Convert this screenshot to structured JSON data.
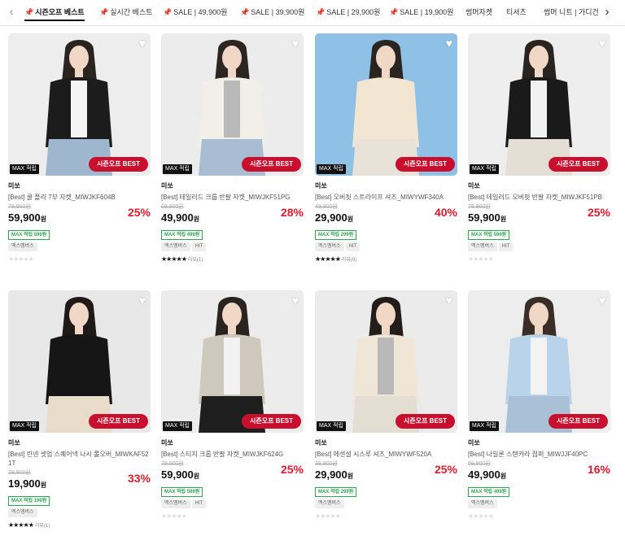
{
  "tabs": [
    {
      "label": "시즌오프 베스트",
      "pin": true,
      "active": true
    },
    {
      "label": "실시간 베스트",
      "pin": true,
      "active": false
    },
    {
      "label": "SALE | 49,900원",
      "pin": true,
      "active": false
    },
    {
      "label": "SALE | 39,900원",
      "pin": true,
      "active": false
    },
    {
      "label": "SALE | 29,900원",
      "pin": true,
      "active": false
    },
    {
      "label": "SALE | 19,900원",
      "pin": true,
      "active": false
    },
    {
      "label": "썸머자켓",
      "pin": false,
      "active": false
    },
    {
      "label": "티셔츠",
      "pin": false,
      "active": false
    },
    {
      "label": "썸머 니트 | 가디건",
      "pin": false,
      "active": false
    }
  ],
  "icons": {
    "prev": "chevron-left-icon",
    "next": "chevron-right-icon",
    "pin": "pin-icon",
    "heart": "heart-icon",
    "star": "star-icon"
  },
  "colors": {
    "accent_red": "#c8102e",
    "discount_red": "#e0192f",
    "max_green": "#2ca650"
  },
  "badges": {
    "max": "MAX 적립",
    "season": "시즌오프 BEST"
  },
  "currency": "원",
  "products": [
    {
      "brand": "미쏘",
      "name": "[Best] 쿨 플리 7부 자켓_MIWJKF604B",
      "orig_price": "79,900원",
      "price": "59,900",
      "rate": "25%",
      "max_point": "MAX 적립 599원",
      "tags": [
        "멕스멤버스"
      ],
      "rating_filled": 0,
      "review": "",
      "img": {
        "bg": "#ededed",
        "top": "#1c1c1c",
        "inner": "#f4f4f4",
        "bottom": "#9fb6cf",
        "hair": "#2a2421"
      }
    },
    {
      "brand": "미쏘",
      "name": "[Best] 테일러드 크롭 반팔 자켓_MIWJKF51PG",
      "orig_price": "69,900원",
      "price": "49,900",
      "rate": "28%",
      "max_point": "MAX 적립 499원",
      "tags": [
        "멕스멤버스",
        "HIT"
      ],
      "rating_filled": 5,
      "review": "리뷰(1)",
      "img": {
        "bg": "#ececec",
        "top": "#f1efe8",
        "inner": "#b9b9b9",
        "bottom": "#a9bdd2",
        "hair": "#2c2522"
      }
    },
    {
      "brand": "미쏘",
      "name": "[Best] 오버핏 스트라이프 셔츠_MIWYWF340A",
      "orig_price": "49,900원",
      "price": "29,900",
      "rate": "40%",
      "max_point": "MAX 적립 299원",
      "tags": [
        "멕스멤버스",
        "HIT"
      ],
      "rating_filled": 5,
      "review": "리뷰(9)",
      "img": {
        "bg": "#8fc0e6",
        "top": "#f2e6d2",
        "inner": "#f2e6d2",
        "bottom": "#e8e2d8",
        "hair": "#2b2522"
      }
    },
    {
      "brand": "미쏘",
      "name": "[Best] 테일러드 오버핏 반팔 자켓_MIWJKF51PB",
      "orig_price": "79,900원",
      "price": "59,900",
      "rate": "25%",
      "max_point": "MAX 적립 599원",
      "tags": [
        "멕스멤버스",
        "HIT"
      ],
      "rating_filled": 0,
      "review": "",
      "img": {
        "bg": "#eeeeee",
        "top": "#1a1a1a",
        "inner": "#f1f1f1",
        "bottom": "#e5ded4",
        "hair": "#2a2421"
      }
    },
    {
      "brand": "미쏘",
      "name": "[Best] 린넨 셋업 스퀘어넥 나시 롤오버_MIWKAF521T",
      "orig_price": "29,900원",
      "price": "19,900",
      "rate": "33%",
      "max_point": "MAX 적립 199원",
      "tags": [
        "멕스멤버스"
      ],
      "rating_filled": 5,
      "review": "리뷰(1)",
      "img": {
        "bg": "#e8e8e8",
        "top": "#161616",
        "inner": "#161616",
        "bottom": "#e9dccb",
        "hair": "#1f1a18"
      }
    },
    {
      "brand": "미쏘",
      "name": "[Best] 스티치 크롭 반팔 자켓_MIWJKF624G",
      "orig_price": "79,900원",
      "price": "59,900",
      "rate": "25%",
      "max_point": "MAX 적립 599원",
      "tags": [
        "멕스멤버스",
        "HIT"
      ],
      "rating_filled": 0,
      "review": "",
      "img": {
        "bg": "#ececec",
        "top": "#cfc8bd",
        "inner": "#f2f2f2",
        "bottom": "#1e1e1e",
        "hair": "#2a2421"
      }
    },
    {
      "brand": "미쏘",
      "name": "[Best] 에센셜 시스루 셔츠_MIWYWF520A",
      "orig_price": "39,900원",
      "price": "29,900",
      "rate": "25%",
      "max_point": "MAX 적립 299원",
      "tags": [
        "멕스멤버스"
      ],
      "rating_filled": 0,
      "review": "",
      "img": {
        "bg": "#ebebeb",
        "top": "#efe6d7",
        "inner": "#b9b9b9",
        "bottom": "#e3ddd2",
        "hair": "#241e1b"
      }
    },
    {
      "brand": "미쏘",
      "name": "[Best] 나일론 스탠카라 점퍼_MIWJJF40PC",
      "orig_price": "59,900원",
      "price": "49,900",
      "rate": "16%",
      "max_point": "MAX 적립 499원",
      "tags": [
        "멕스멤버스"
      ],
      "rating_filled": 0,
      "review": "",
      "img": {
        "bg": "#ededed",
        "top": "#b9d3ea",
        "inner": "#f3f3f3",
        "bottom": "#aac0d6",
        "hair": "#3a2c26"
      }
    }
  ]
}
